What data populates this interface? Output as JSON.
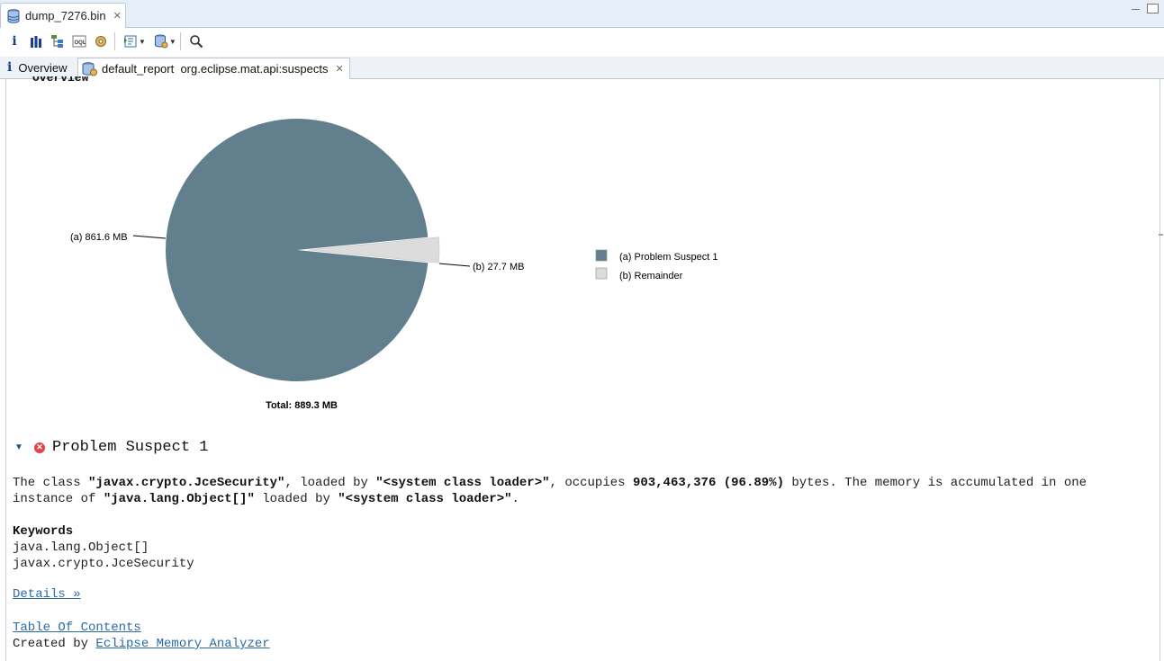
{
  "editor": {
    "tab_title": "dump_7276.bin"
  },
  "page_tabs": {
    "overview": "Overview",
    "report": "default_report  org.eclipse.mat.api:suspects"
  },
  "report": {
    "overview_heading": "Overview",
    "chart_data": {
      "type": "pie",
      "slices": [
        {
          "label": "(a)",
          "value_mb": 861.6,
          "value_text": "861.6 MB",
          "legend": "Problem Suspect 1",
          "color": "#627f8d"
        },
        {
          "label": "(b)",
          "value_mb": 27.7,
          "value_text": "27.7 MB",
          "legend": "Remainder",
          "color": "#dcdcdc"
        }
      ],
      "total": "Total: 889.3 MB"
    },
    "legend": {
      "a_label": "(a)",
      "a_text": "Problem Suspect 1",
      "b_label": "(b)",
      "b_text": "Remainder"
    },
    "suspect": {
      "title": "Problem Suspect 1",
      "p1": "The class ",
      "class_name": "\"javax.crypto.JceSecurity\"",
      "p2": ", loaded by ",
      "loader1": "\"<system class loader>\"",
      "p3": ", occupies ",
      "size": "903,463,376 (96.89%)",
      "p4": " bytes. The memory is accumulated in one instance of ",
      "instance": "\"java.lang.Object[]\"",
      "p5": " loaded by ",
      "loader2": "\"<system class loader>\"",
      "p6": ".",
      "keywords_title": "Keywords",
      "keywords": [
        "java.lang.Object[]",
        "javax.crypto.JceSecurity"
      ],
      "details_link": "Details »"
    },
    "toc_link": "Table Of Contents",
    "created_by": "Created by ",
    "created_link": "Eclipse Memory Analyzer"
  }
}
